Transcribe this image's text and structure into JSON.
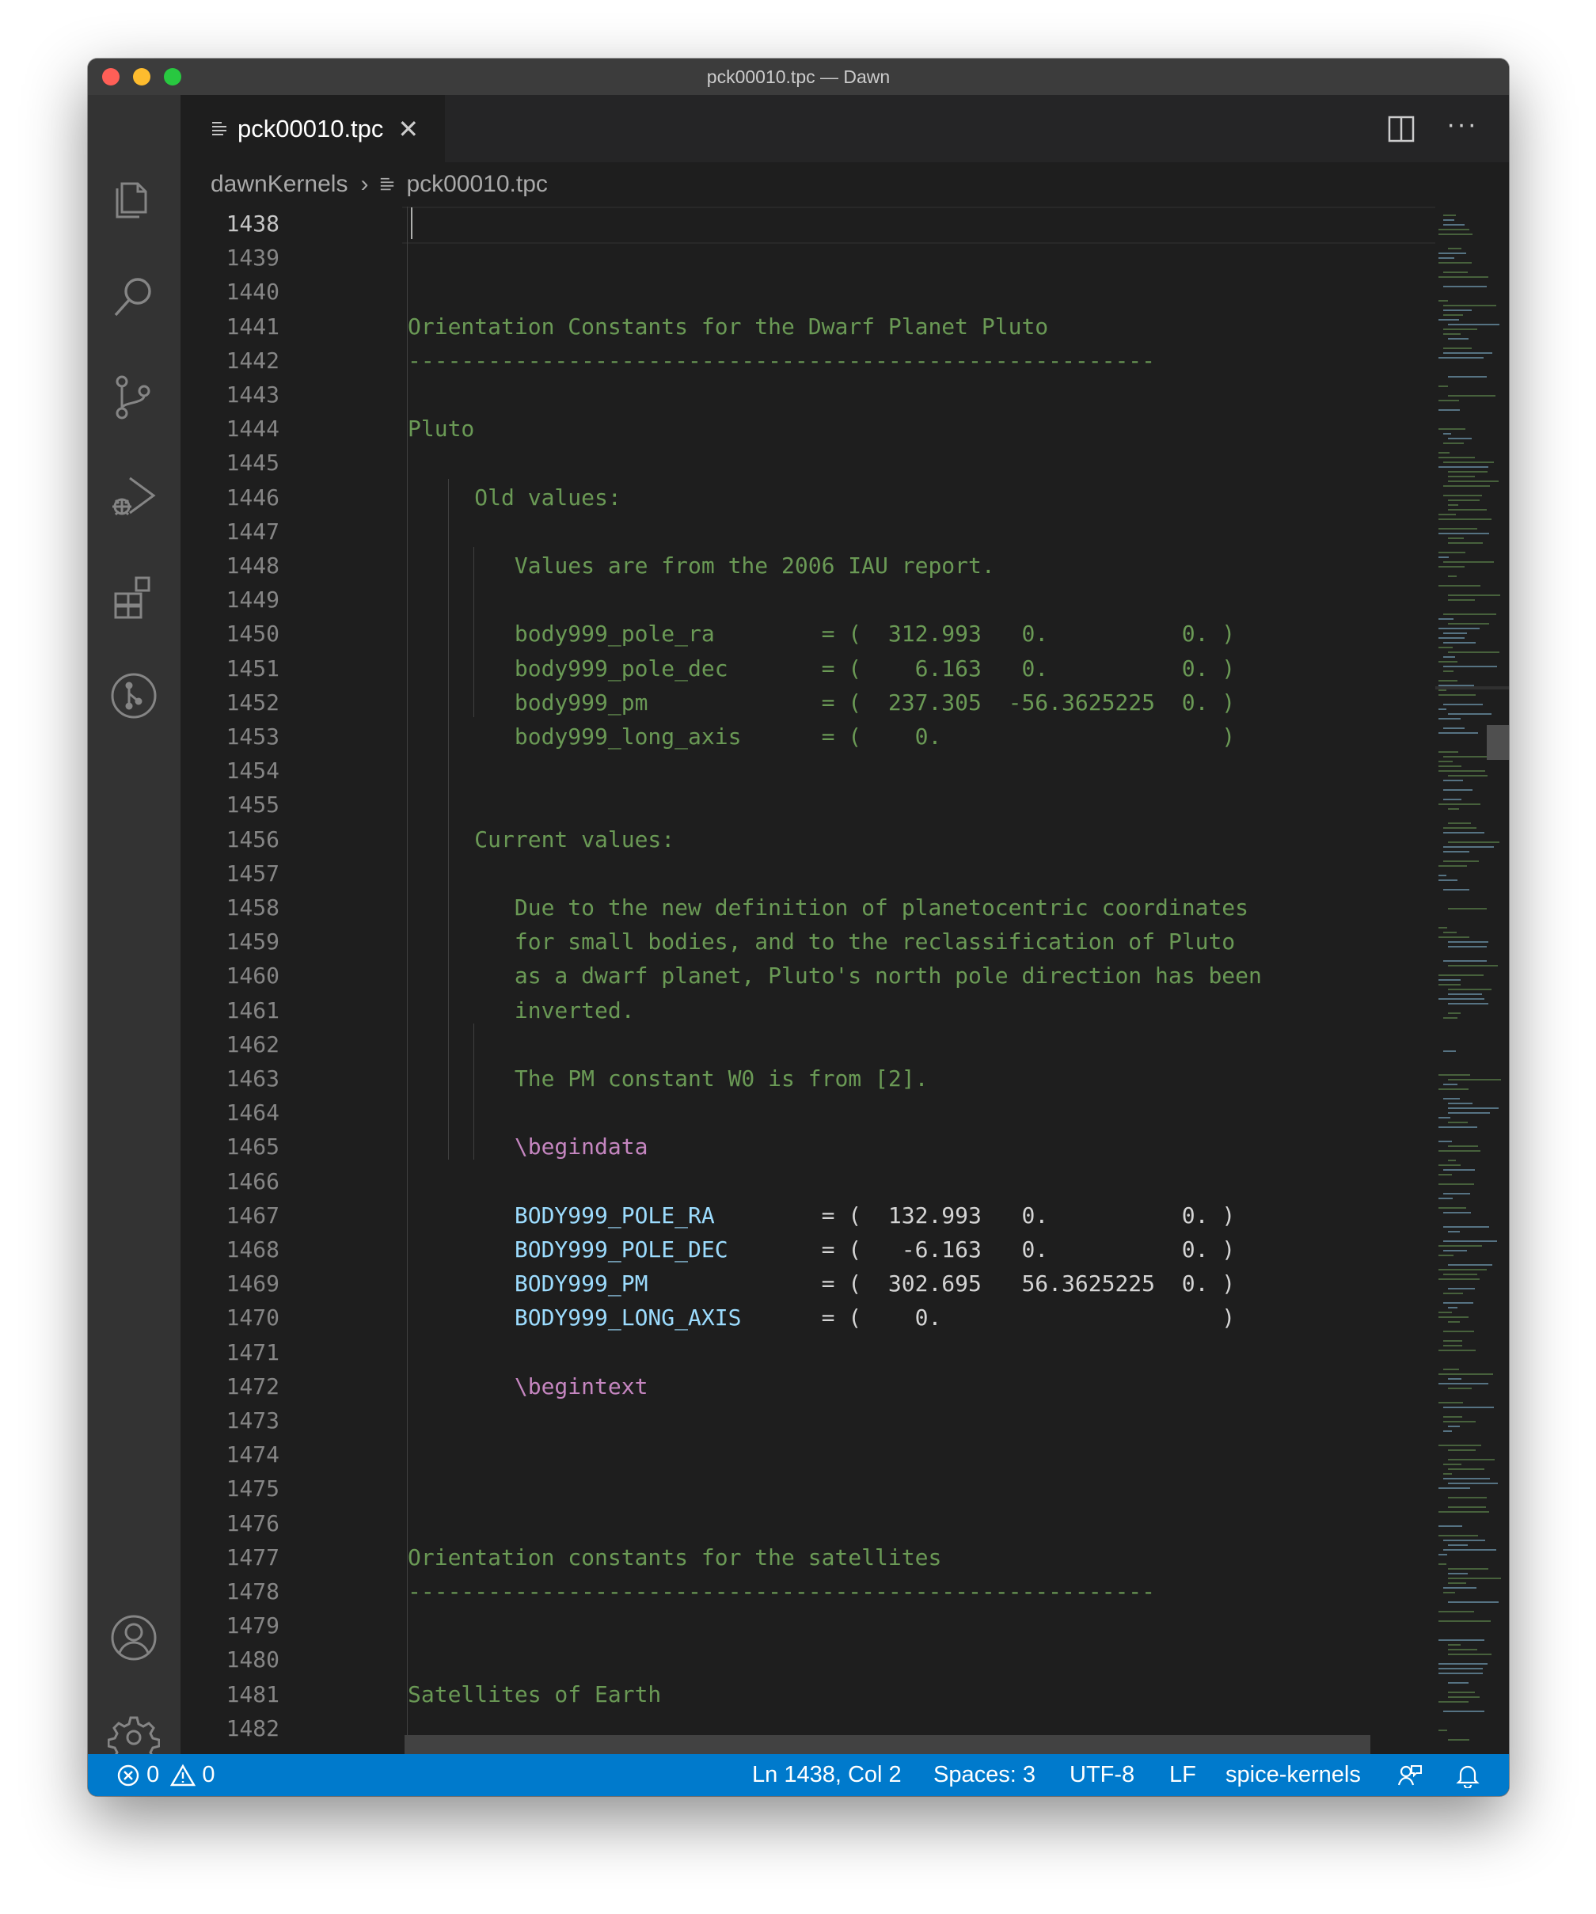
{
  "window": {
    "title": "pck00010.tpc — Dawn"
  },
  "activity_bar": {
    "items": [
      "explorer-icon",
      "search-icon",
      "source-control-icon",
      "run-debug-icon",
      "extensions-icon",
      "git-graph-icon"
    ],
    "bottom_items": [
      "account-icon",
      "settings-gear-icon"
    ]
  },
  "tabs": [
    {
      "label": "pck00010.tpc",
      "active": true
    }
  ],
  "breadcrumb": {
    "folder": "dawnKernels",
    "file": "pck00010.tpc"
  },
  "editor": {
    "line_numbers": [
      "1438",
      "1439",
      "1440",
      "1441",
      "1442",
      "1443",
      "1444",
      "1445",
      "1446",
      "1447",
      "1448",
      "1449",
      "1450",
      "1451",
      "1452",
      "1453",
      "1454",
      "1455",
      "1456",
      "1457",
      "1458",
      "1459",
      "1460",
      "1461",
      "1462",
      "1463",
      "1464",
      "1465",
      "1466",
      "1467",
      "1468",
      "1469",
      "1470",
      "1471",
      "1472",
      "1473",
      "1474",
      "1475",
      "1476",
      "1477",
      "1478",
      "1479",
      "1480",
      "1481",
      "1482"
    ],
    "lines": [
      {
        "text": "",
        "kind": "comment"
      },
      {
        "text": "",
        "kind": "comment"
      },
      {
        "text": "",
        "kind": "comment"
      },
      {
        "text": "Orientation Constants for the Dwarf Planet Pluto",
        "kind": "comment"
      },
      {
        "text": "--------------------------------------------------------",
        "kind": "comment"
      },
      {
        "text": "",
        "kind": "comment"
      },
      {
        "text": "Pluto",
        "kind": "comment"
      },
      {
        "text": "",
        "kind": "comment"
      },
      {
        "text": "     Old values:",
        "kind": "comment"
      },
      {
        "text": "",
        "kind": "comment"
      },
      {
        "text": "        Values are from the 2006 IAU report.",
        "kind": "comment"
      },
      {
        "text": "",
        "kind": "comment"
      },
      {
        "text": "        body999_pole_ra        = (  312.993   0.          0. )",
        "kind": "comment"
      },
      {
        "text": "        body999_pole_dec       = (    6.163   0.          0. )",
        "kind": "comment"
      },
      {
        "text": "        body999_pm             = (  237.305  -56.3625225  0. )",
        "kind": "comment"
      },
      {
        "text": "        body999_long_axis      = (    0.                     )",
        "kind": "comment"
      },
      {
        "text": "",
        "kind": "comment"
      },
      {
        "text": "",
        "kind": "comment"
      },
      {
        "text": "     Current values:",
        "kind": "comment"
      },
      {
        "text": "",
        "kind": "comment"
      },
      {
        "text": "        Due to the new definition of planetocentric coordinates",
        "kind": "comment"
      },
      {
        "text": "        for small bodies, and to the reclassification of Pluto",
        "kind": "comment"
      },
      {
        "text": "        as a dwarf planet, Pluto's north pole direction has been",
        "kind": "comment"
      },
      {
        "text": "        inverted.",
        "kind": "comment"
      },
      {
        "text": "",
        "kind": "comment"
      },
      {
        "text": "        The PM constant W0 is from [2].",
        "kind": "comment"
      },
      {
        "text": "",
        "kind": "comment"
      },
      {
        "text": "        \\begindata",
        "kind": "keyword"
      },
      {
        "text": "",
        "kind": "comment"
      },
      {
        "text": "        BODY999_POLE_RA",
        "rest": "        = (  132.993   0.          0. )",
        "kind": "variable"
      },
      {
        "text": "        BODY999_POLE_DEC",
        "rest": "       = (   -6.163   0.          0. )",
        "kind": "variable"
      },
      {
        "text": "        BODY999_PM",
        "rest": "             = (  302.695   56.3625225  0. )",
        "kind": "variable"
      },
      {
        "text": "        BODY999_LONG_AXIS",
        "rest": "      = (    0.                     )",
        "kind": "variable"
      },
      {
        "text": "",
        "kind": "comment"
      },
      {
        "text": "        \\begintext",
        "kind": "keyword"
      },
      {
        "text": "",
        "kind": "comment"
      },
      {
        "text": "",
        "kind": "comment"
      },
      {
        "text": "",
        "kind": "comment"
      },
      {
        "text": "",
        "kind": "comment"
      },
      {
        "text": "Orientation constants for the satellites",
        "kind": "comment"
      },
      {
        "text": "--------------------------------------------------------",
        "kind": "comment"
      },
      {
        "text": "",
        "kind": "comment"
      },
      {
        "text": "",
        "kind": "comment"
      },
      {
        "text": "Satellites of Earth",
        "kind": "comment"
      },
      {
        "text": "",
        "kind": "comment"
      }
    ]
  },
  "status_bar": {
    "errors": "0",
    "warnings": "0",
    "cursor": "Ln 1438, Col 2",
    "indent": "Spaces: 3",
    "encoding": "UTF-8",
    "eol": "LF",
    "language": "spice-kernels"
  },
  "colors": {
    "accent": "#007acc",
    "comment": "#6a9955",
    "keyword": "#c586c0",
    "variable": "#9cdcfe",
    "editor_bg": "#1e1e1e"
  }
}
